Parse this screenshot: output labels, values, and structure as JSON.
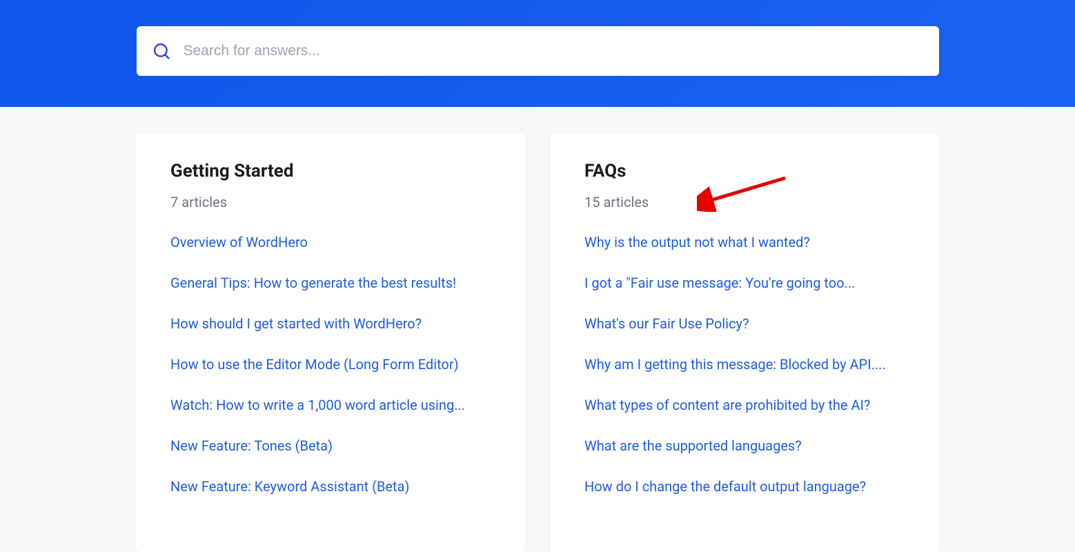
{
  "search": {
    "placeholder": "Search for answers..."
  },
  "cards": [
    {
      "title": "Getting Started",
      "count": "7 articles",
      "articles": [
        "Overview of WordHero",
        "General Tips: How to generate the best results!",
        "How should I get started with WordHero?",
        "How to use the Editor Mode (Long Form Editor)",
        "Watch: How to write a 1,000 word article using...",
        "New Feature: Tones (Beta)",
        "New Feature: Keyword Assistant (Beta)"
      ]
    },
    {
      "title": "FAQs",
      "count": "15 articles",
      "articles": [
        "Why is the output not what I wanted?",
        "I got a \"Fair use message: You're going too...",
        "What's our Fair Use Policy?",
        "Why am I getting this message: Blocked by API....",
        "What types of content are prohibited by the AI?",
        "What are the supported languages?",
        "How do I change the default output language?"
      ]
    }
  ]
}
